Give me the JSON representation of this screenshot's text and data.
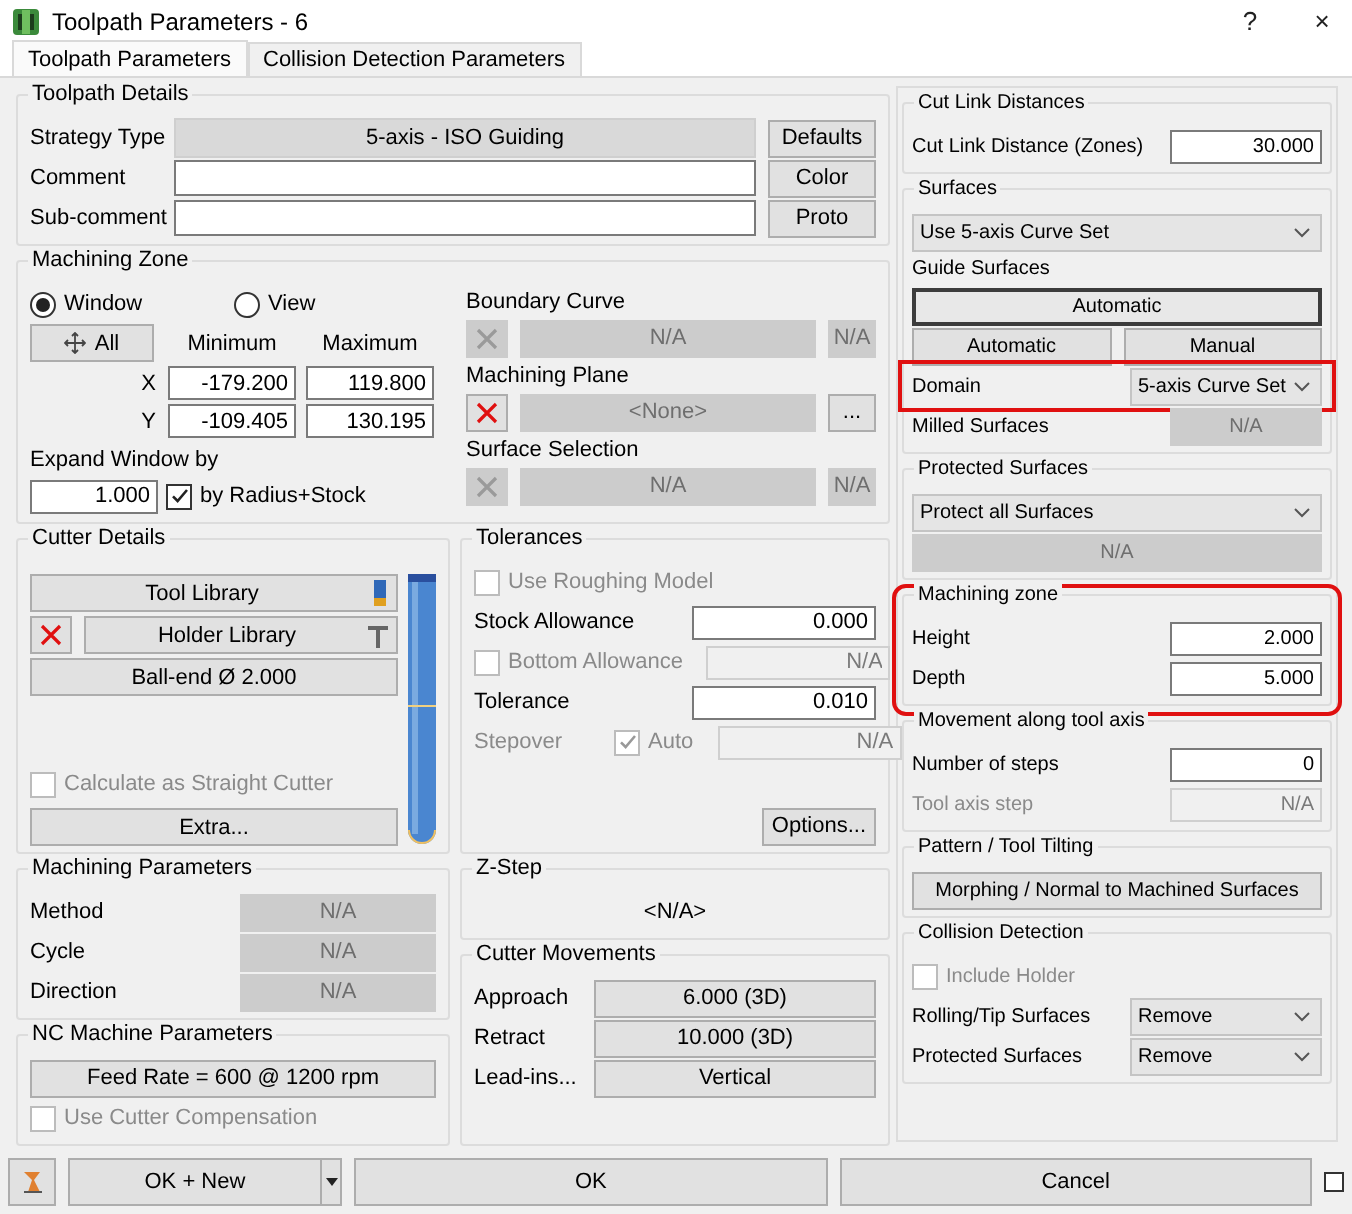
{
  "window": {
    "title": "Toolpath Parameters - 6",
    "help": "?",
    "close": "×"
  },
  "tabs": [
    {
      "label": "Toolpath Parameters",
      "selected": true
    },
    {
      "label": "Collision Detection Parameters",
      "selected": false
    }
  ],
  "toolpath_details": {
    "title": "Toolpath Details",
    "rows": [
      {
        "kind": "display",
        "label": "Strategy Type",
        "value": "5-axis - ISO Guiding",
        "button": "Defaults"
      },
      {
        "kind": "input",
        "label": "Comment",
        "button": "Color"
      },
      {
        "kind": "input",
        "label": "Sub-comment",
        "button": "Proto"
      }
    ]
  },
  "machining_zone": {
    "title": "Machining Zone",
    "modes": [
      {
        "label": "Window",
        "selected": true
      },
      {
        "label": "View",
        "selected": false
      }
    ],
    "all_button": "All",
    "columns": [
      "Minimum",
      "Maximum"
    ],
    "axes": [
      {
        "label": "X",
        "min": "-179.200",
        "max": "119.800"
      },
      {
        "label": "Y",
        "min": "-109.405",
        "max": "130.195"
      }
    ],
    "expand": {
      "label": "Expand Window by",
      "value": "1.000",
      "check": {
        "label": "by Radius+Stock",
        "checked": true
      }
    },
    "pickers": [
      {
        "title": "Boundary Curve",
        "enabled": false,
        "value": "N/A",
        "side": "N/A"
      },
      {
        "title": "Machining Plane",
        "enabled": true,
        "value": "<None>",
        "side": "..."
      },
      {
        "title": "Surface Selection",
        "enabled": false,
        "value": "N/A",
        "side": "N/A"
      }
    ]
  },
  "cutter_details": {
    "title": "Cutter Details",
    "tool_library": "Tool Library",
    "holder_library": "Holder Library",
    "cutter": "Ball-end Ø 2.000",
    "straight": {
      "label": "Calculate as Straight Cutter",
      "checked": false,
      "disabled": true
    },
    "extra": "Extra..."
  },
  "tolerances": {
    "title": "Tolerances",
    "rows": [
      {
        "kind": "check",
        "label": "Use Roughing Model",
        "checked": false,
        "disabled": true
      },
      {
        "kind": "input",
        "label": "Stock Allowance",
        "value": "0.000",
        "disabled": false
      },
      {
        "kind": "check_input",
        "label": "Bottom Allowance",
        "checked": false,
        "disabled": true,
        "value": "N/A"
      },
      {
        "kind": "input",
        "label": "Tolerance",
        "value": "0.010",
        "disabled": false
      },
      {
        "kind": "stepover",
        "label": "Stepover",
        "check": "Auto",
        "checked": true,
        "disabled": true,
        "value": "N/A"
      }
    ],
    "options": "Options..."
  },
  "left_lower": [
    {
      "title": "Machining Parameters",
      "rows": [
        {
          "kind": "button_row",
          "label": "Method",
          "value": "N/A",
          "disabled": true
        },
        {
          "kind": "button_row",
          "label": "Cycle",
          "value": "N/A",
          "disabled": true
        },
        {
          "kind": "button_row",
          "label": "Direction",
          "value": "N/A",
          "disabled": true
        }
      ]
    },
    {
      "title": "NC Machine Parameters",
      "rows": [
        {
          "kind": "button",
          "text": "Feed Rate = 600 @ 1200 rpm",
          "disabled": false
        },
        {
          "kind": "check",
          "label": "Use Cutter Compensation",
          "checked": false,
          "disabled": true
        }
      ]
    }
  ],
  "middle_lower": [
    {
      "title": "Z-Step",
      "rows": [
        {
          "kind": "center",
          "text": "<N/A>"
        }
      ]
    },
    {
      "title": "Cutter Movements",
      "rows": [
        {
          "kind": "button_row",
          "label": "Approach",
          "value": "6.000 (3D)",
          "disabled": false
        },
        {
          "kind": "button_row",
          "label": "Retract",
          "value": "10.000 (3D)",
          "disabled": false
        },
        {
          "kind": "button_row",
          "label": "Lead-ins...",
          "value": "Vertical",
          "disabled": false
        }
      ]
    }
  ],
  "right": [
    {
      "title": "Cut Link Distances",
      "rows": [
        {
          "kind": "input",
          "label": "Cut Link Distance (Zones)",
          "value": "30.000",
          "disabled": false
        }
      ]
    },
    {
      "title": "Surfaces",
      "rows": [
        {
          "kind": "combo",
          "value": "Use 5-axis Curve Set"
        },
        {
          "kind": "sub",
          "text": "Guide Surfaces"
        },
        {
          "kind": "button",
          "text": "Automatic",
          "default": true,
          "disabled": false
        },
        {
          "kind": "pair",
          "buttons": [
            "Automatic",
            "Manual"
          ]
        },
        {
          "kind": "combo",
          "label": "Domain",
          "value": "5-axis Curve Set",
          "highlight": true
        },
        {
          "kind": "button_row",
          "label": "Milled Surfaces",
          "value": "N/A",
          "disabled": true
        }
      ]
    },
    {
      "title": "Protected Surfaces",
      "rows": [
        {
          "kind": "combo",
          "value": "Protect all Surfaces"
        },
        {
          "kind": "button",
          "text": "N/A",
          "disabled": true
        }
      ]
    },
    {
      "title": "Machining zone",
      "highlight": true,
      "rows": [
        {
          "kind": "input",
          "label": "Height",
          "value": "2.000",
          "disabled": false
        },
        {
          "kind": "input",
          "label": "Depth",
          "value": "5.000",
          "disabled": false
        }
      ]
    },
    {
      "title": "Movement along tool axis",
      "rows": [
        {
          "kind": "input",
          "label": "Number of steps",
          "value": "0",
          "disabled": false
        },
        {
          "kind": "input",
          "label": "Tool axis step",
          "value": "N/A",
          "disabled": true
        }
      ]
    },
    {
      "title": "Pattern / Tool Tilting",
      "rows": [
        {
          "kind": "button",
          "text": "Morphing / Normal to Machined Surfaces",
          "disabled": false
        }
      ]
    },
    {
      "title": "Collision Detection",
      "rows": [
        {
          "kind": "check",
          "label": "Include Holder",
          "checked": false,
          "disabled": true
        },
        {
          "kind": "combo",
          "label": "Rolling/Tip Surfaces",
          "value": "Remove"
        },
        {
          "kind": "combo",
          "label": "Protected Surfaces",
          "value": "Remove"
        }
      ]
    }
  ],
  "footer": {
    "ok_new": "OK + New",
    "ok": "OK",
    "cancel": "Cancel"
  }
}
